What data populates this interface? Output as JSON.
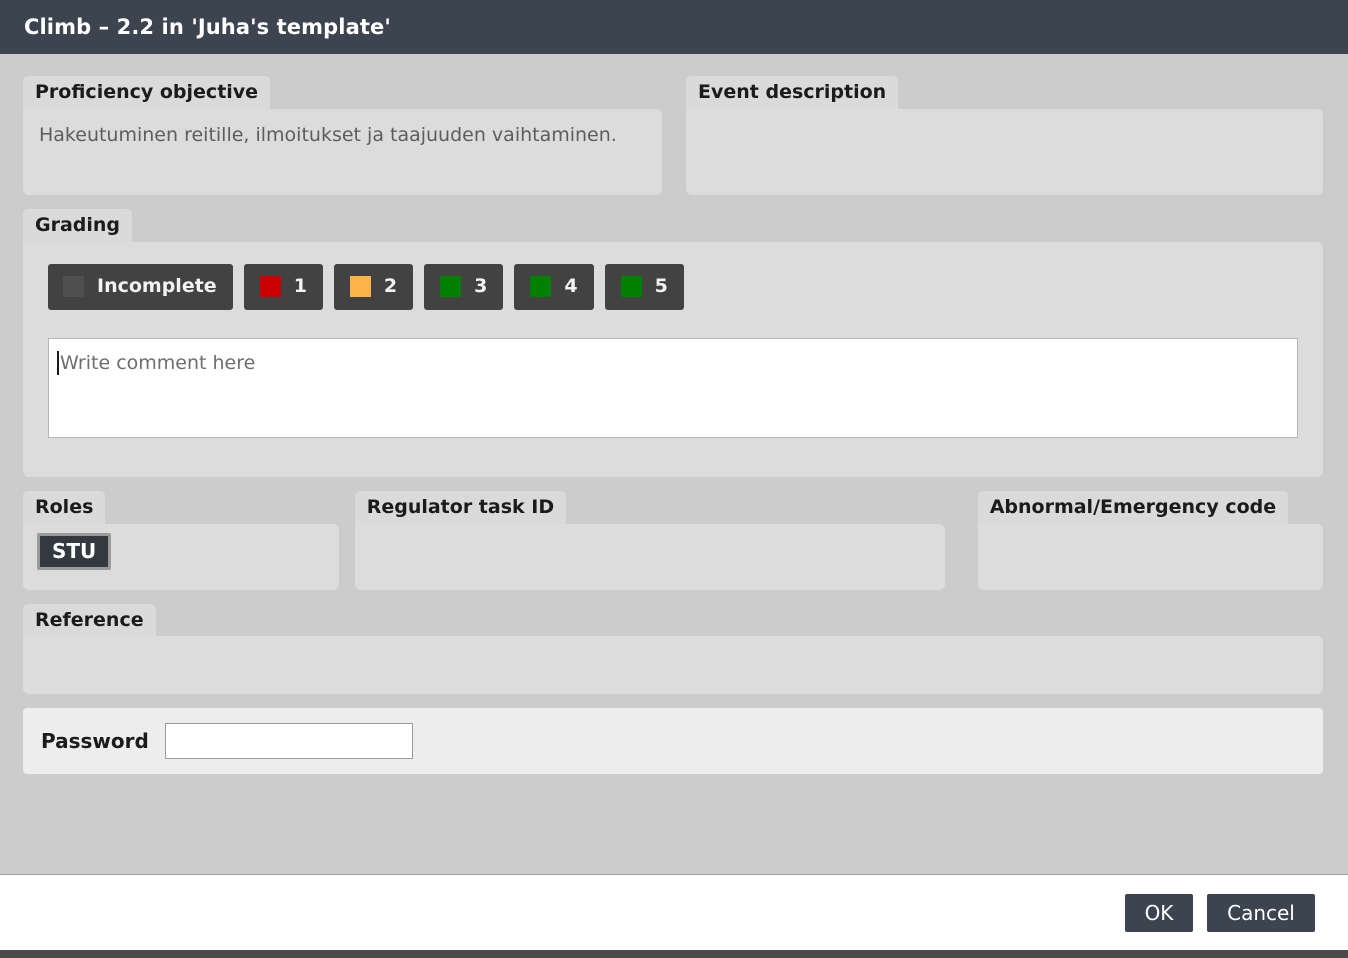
{
  "window": {
    "title": "Climb – 2.2 in 'Juha's template'"
  },
  "proficiency": {
    "label": "Proficiency objective",
    "value": "Hakeutuminen reitille, ilmoitukset ja taajuuden vaihtaminen."
  },
  "event_description": {
    "label": "Event description",
    "value": ""
  },
  "grading": {
    "label": "Grading",
    "options": [
      {
        "label": "Incomplete",
        "color": "#4f4f4f",
        "name": "grade-incomplete"
      },
      {
        "label": "1",
        "color": "#cc0000",
        "name": "grade-1"
      },
      {
        "label": "2",
        "color": "#ffb44a",
        "name": "grade-2"
      },
      {
        "label": "3",
        "color": "#008000",
        "name": "grade-3"
      },
      {
        "label": "4",
        "color": "#008000",
        "name": "grade-4"
      },
      {
        "label": "5",
        "color": "#008000",
        "name": "grade-5"
      }
    ],
    "comment": {
      "placeholder": "Write comment here",
      "value": ""
    }
  },
  "roles": {
    "label": "Roles",
    "chips": [
      {
        "label": "STU",
        "selected": true
      }
    ]
  },
  "regulator_task_id": {
    "label": "Regulator task ID",
    "value": ""
  },
  "abnormal_emergency_code": {
    "label": "Abnormal/Emergency code",
    "value": ""
  },
  "reference": {
    "label": "Reference",
    "value": ""
  },
  "password": {
    "label": "Password",
    "value": "",
    "placeholder": ""
  },
  "footer": {
    "ok_label": "OK",
    "cancel_label": "Cancel"
  },
  "colors": {
    "titlebar": "#3c4450",
    "background": "#cccccc",
    "panel": "#dcdcdc",
    "tab": "#dadada",
    "button_dark": "#424242",
    "accent_button": "#3c4450"
  }
}
